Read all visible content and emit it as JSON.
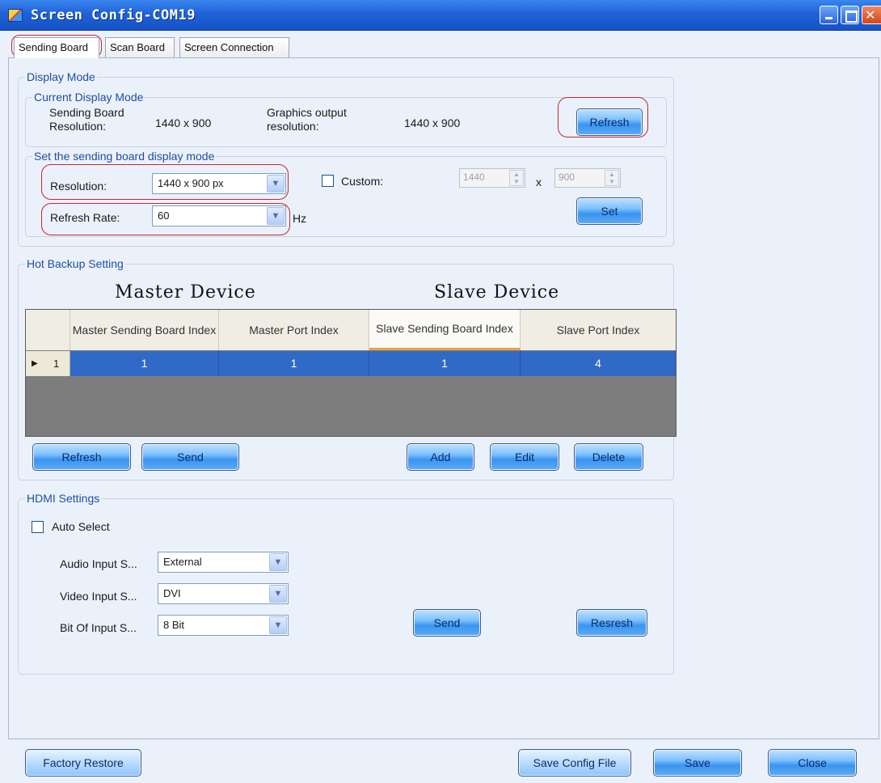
{
  "window": {
    "title": "Screen Config-COM19"
  },
  "tabs": [
    {
      "label": "Sending Board"
    },
    {
      "label": "Scan Board"
    },
    {
      "label": "Screen Connection"
    }
  ],
  "display_mode": {
    "title": "Display Mode",
    "current": {
      "title": "Current Display Mode",
      "sending_label": "Sending Board Resolution:",
      "sending_value": "1440 x 900",
      "graphics_label": "Graphics output resolution:",
      "graphics_value": "1440 x 900",
      "refresh_button": "Refresh"
    },
    "set": {
      "title": "Set the sending board display mode",
      "resolution_label": "Resolution:",
      "resolution_value": "1440 x 900 px",
      "custom_label": "Custom:",
      "custom_width": "1440",
      "custom_x": "x",
      "custom_height": "900",
      "refresh_rate_label": "Refresh Rate:",
      "refresh_rate_value": "60",
      "hz": "Hz",
      "set_button": "Set"
    }
  },
  "hot_backup": {
    "title": "Hot Backup Setting",
    "master_title": "Master Device",
    "slave_title": "Slave Device",
    "columns": [
      "Master Sending Board Index",
      "Master Port Index",
      "Slave Sending Board Index",
      "Slave Port Index"
    ],
    "rows": [
      {
        "num": "1",
        "cells": [
          "1",
          "1",
          "1",
          "4"
        ]
      }
    ],
    "buttons": {
      "refresh": "Refresh",
      "send": "Send",
      "add": "Add",
      "edit": "Edit",
      "delete": "Delete"
    }
  },
  "hdmi": {
    "title": "HDMI Settings",
    "auto_select_label": "Auto Select",
    "audio_label": "Audio Input S...",
    "audio_value": "External",
    "video_label": "Video Input S...",
    "video_value": "DVI",
    "bit_label": "Bit Of Input S...",
    "bit_value": "8 Bit",
    "send_button": "Send",
    "refresh_button": "Resresh"
  },
  "footer": {
    "factory_restore": "Factory Restore",
    "save_config": "Save Config File",
    "save": "Save",
    "close": "Close"
  },
  "colors": {
    "titlebar": "#1f62d8",
    "selected_row": "#3169c6",
    "highlight": "#c8262c"
  }
}
